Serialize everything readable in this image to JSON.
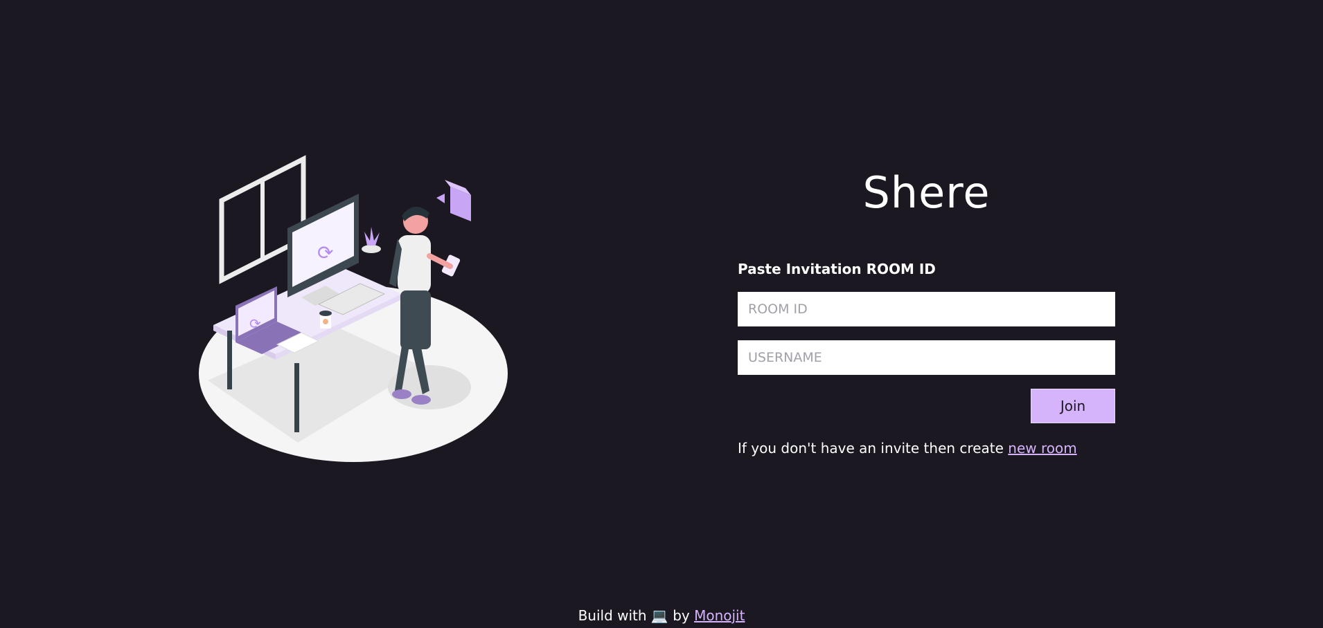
{
  "app": {
    "title": "Shere"
  },
  "form": {
    "label": "Paste Invitation ROOM ID",
    "room_id_placeholder": "ROOM ID",
    "room_id_value": "",
    "username_placeholder": "USERNAME",
    "username_value": "",
    "join_label": "Join",
    "invite_text": "If you don't have an invite then create ",
    "new_room_link": "new room"
  },
  "footer": {
    "prefix": "Build with",
    "emoji": "💻",
    "by": "by",
    "author_link": "Monojit"
  },
  "illustration": {
    "icon": "workspace-illustration"
  },
  "colors": {
    "background": "#1b1822",
    "accent": "#d6b4fc",
    "text": "#ffffff"
  }
}
